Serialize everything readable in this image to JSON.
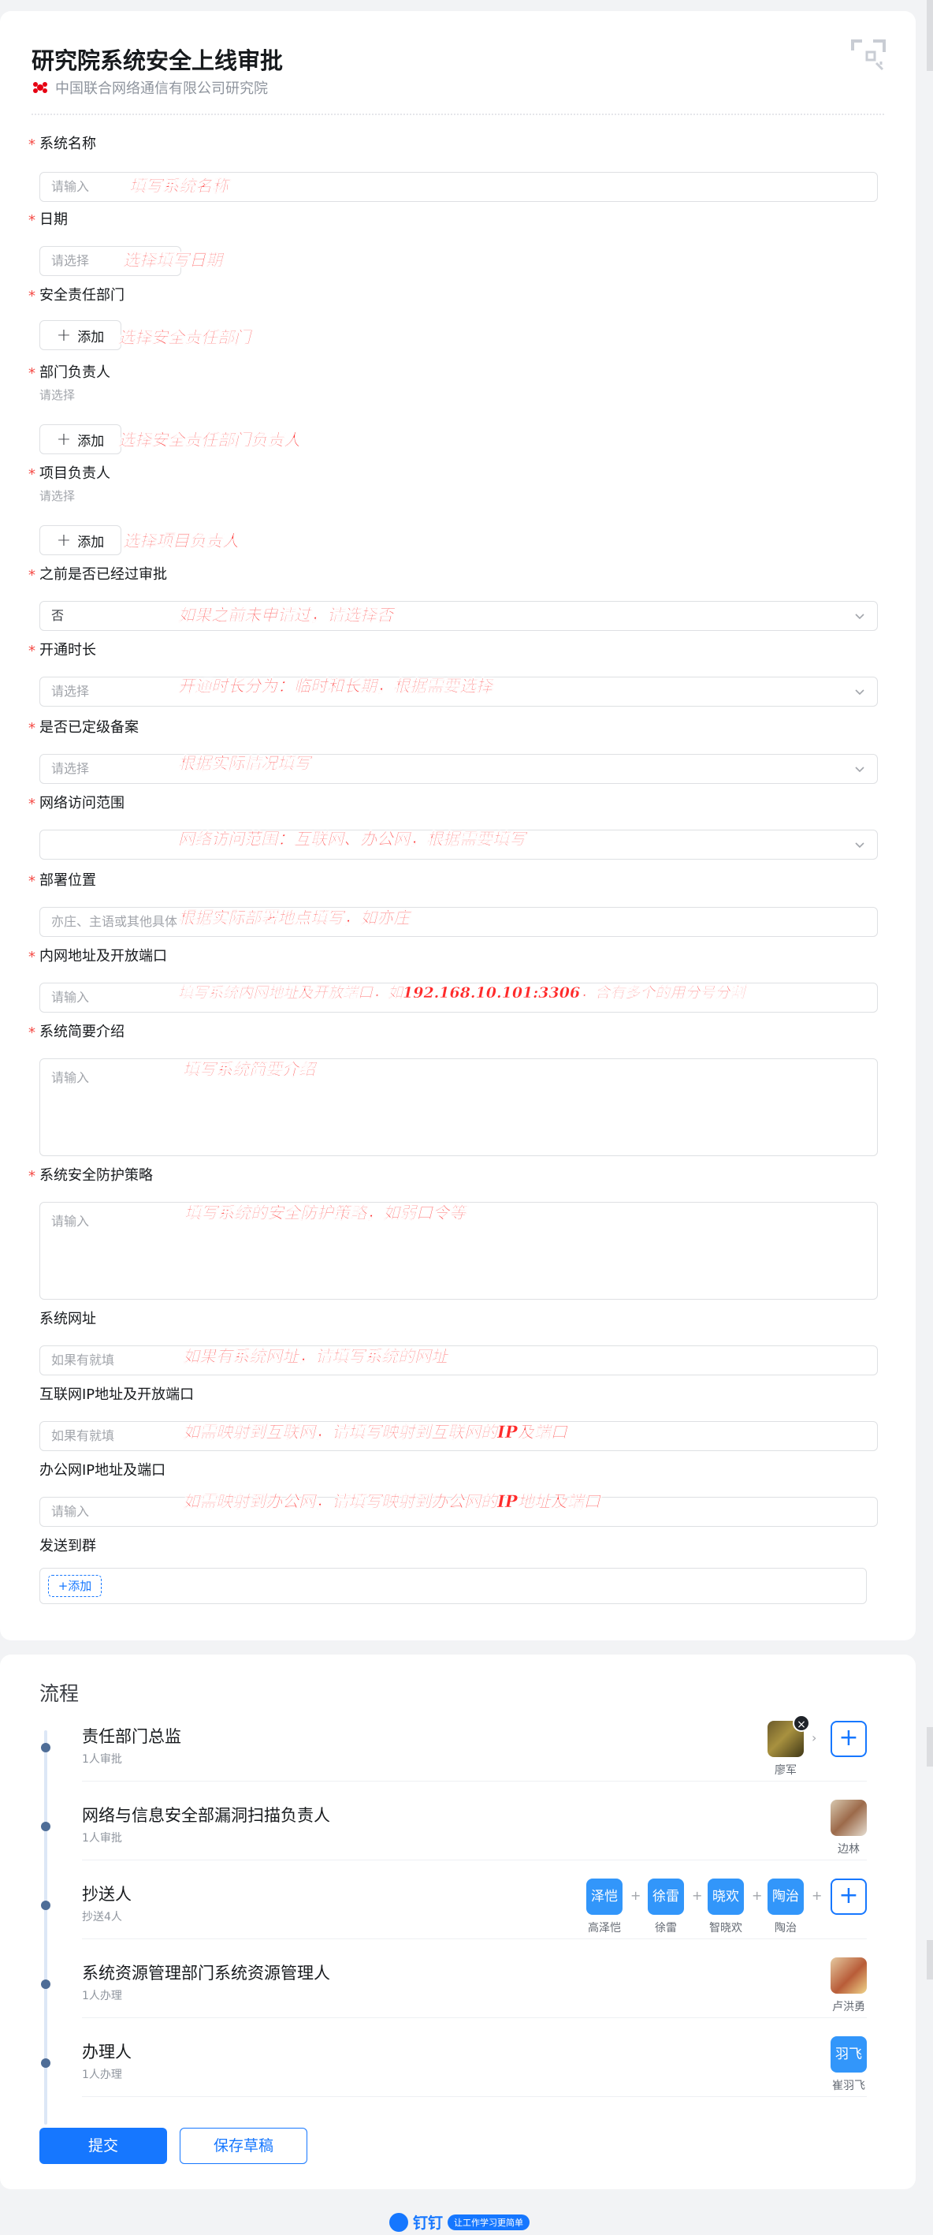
{
  "header": {
    "title": "研究院系统安全上线审批",
    "org": "中国联合网络通信有限公司研究院"
  },
  "fields": [
    {
      "label": "系统名称",
      "required": true,
      "placeholder": "请输入",
      "annotation": "填写系统名称"
    },
    {
      "label": "日期",
      "required": true,
      "placeholder": "请选择",
      "annotation": "选择填写日期"
    },
    {
      "label": "安全责任部门",
      "required": true,
      "button": "添加",
      "annotation": "选择安全责任部门"
    },
    {
      "label": "部门负责人",
      "required": true,
      "sub": "请选择",
      "button": "添加",
      "annotation": "选择安全责任部门负责人"
    },
    {
      "label": "项目负责人",
      "required": true,
      "sub": "请选择",
      "button": "添加",
      "annotation": "选择项目负责人"
    },
    {
      "label": "之前是否已经过审批",
      "required": true,
      "value": "否",
      "annotation": "如果之前未申请过，请选择否"
    },
    {
      "label": "开通时长",
      "required": true,
      "placeholder": "请选择",
      "annotation": "开通时长分为：临时和长期，根据需要选择"
    },
    {
      "label": "是否已定级备案",
      "required": true,
      "placeholder": "请选择",
      "annotation": "根据实际情况填写"
    },
    {
      "label": "网络访问范围",
      "required": true,
      "placeholder": "",
      "annotation": "网络访问范围：互联网、办公网，根据需要填写"
    },
    {
      "label": "部署位置",
      "required": true,
      "placeholder": "亦庄、主语或其他具体",
      "annotation": "根据实际部署地点填写，如亦庄"
    },
    {
      "label": "内网地址及开放端口",
      "required": true,
      "placeholder": "请输入",
      "annotation": "填写系统内网地址及开放端口，如192.168.10.101:3306，含有多个的用分号分割"
    },
    {
      "label": "系统简要介绍",
      "required": true,
      "placeholder": "请输入",
      "annotation": "填写系统简要介绍"
    },
    {
      "label": "系统安全防护策略",
      "required": true,
      "placeholder": "请输入",
      "annotation": "填写系统的安全防护策略，如弱口令等"
    },
    {
      "label": "系统网址",
      "required": false,
      "placeholder": "如果有就填",
      "annotation": "如果有系统网址，请填写系统的网址"
    },
    {
      "label": "互联网IP地址及开放端口",
      "required": false,
      "placeholder": "如果有就填",
      "annotation": "如需映射到互联网，请填写映射到互联网的IP及端口"
    },
    {
      "label": "办公网IP地址及端口",
      "required": false,
      "placeholder": "请输入",
      "annotation": "如需映射到办公网，请填写映射到办公网的IP地址及端口"
    },
    {
      "label": "发送到群",
      "required": false,
      "button": "+添加"
    }
  ],
  "flow": {
    "title": "流程",
    "steps": [
      {
        "name": "责任部门总监",
        "count": "1人审批",
        "people": [
          {
            "name": "廖军",
            "avatar": "photo"
          }
        ]
      },
      {
        "name": "网络与信息安全部漏洞扫描负责人",
        "count": "1人审批",
        "people": [
          {
            "name": "边林",
            "avatar": "photo"
          }
        ]
      },
      {
        "name": "抄送人",
        "count": "抄送4人",
        "people": [
          {
            "name": "高泽恺",
            "avatar_text": "泽恺"
          },
          {
            "name": "徐雷",
            "avatar_text": "徐雷"
          },
          {
            "name": "智晓欢",
            "avatar_text": "晓欢"
          },
          {
            "name": "陶治",
            "avatar_text": "陶治"
          }
        ]
      },
      {
        "name": "系统资源管理部门系统资源管理人",
        "count": "1人办理",
        "people": [
          {
            "name": "卢洪勇",
            "avatar": "photo"
          }
        ]
      },
      {
        "name": "办理人",
        "count": "1人办理",
        "people": [
          {
            "name": "崔羽飞",
            "avatar_text": "羽飞"
          }
        ]
      }
    ]
  },
  "actions": {
    "submit": "提交",
    "draft": "保存草稿"
  },
  "footer": {
    "brand": "钉钉",
    "slogan": "让工作学习更简单"
  },
  "colors": {
    "accent": "#1677ff",
    "required": "#f54a45",
    "annotation": "#ff2a2a"
  }
}
